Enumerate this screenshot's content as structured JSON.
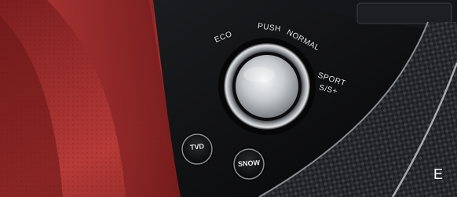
{
  "image": {
    "drive_mode_labels": {
      "eco": "ECO",
      "push": "PUSH",
      "normal": "NORMAL",
      "sport": "SPORT",
      "sport_plus": "S/S+"
    },
    "buttons": {
      "tvd": "TVD",
      "snow": "SNOW"
    },
    "corner_letter": "E"
  },
  "colors": {
    "seat_red": "#9e2a2b",
    "console_black": "#0d0e10",
    "carbon": "#2a2b2e",
    "chrome": "#d9dcdf"
  }
}
